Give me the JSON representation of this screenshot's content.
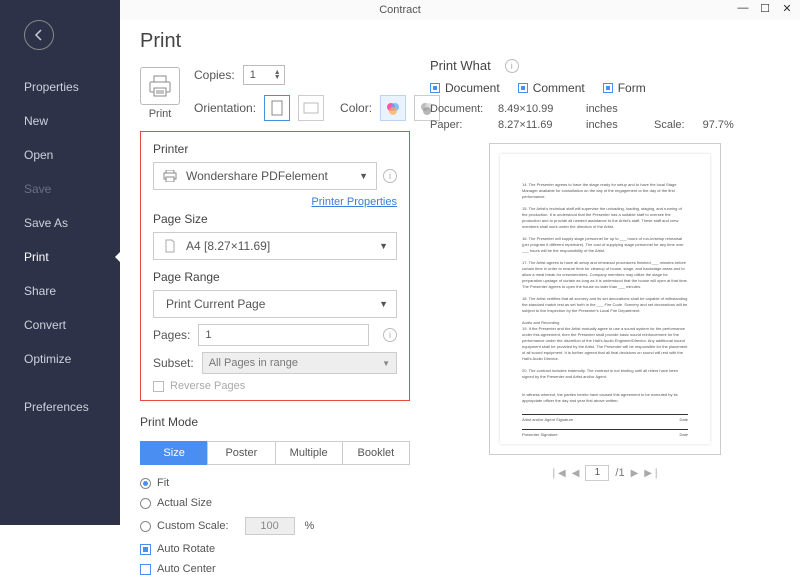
{
  "window": {
    "title": "Contract"
  },
  "sidebar": {
    "items": [
      {
        "label": "Properties"
      },
      {
        "label": "New"
      },
      {
        "label": "Open"
      },
      {
        "label": "Save"
      },
      {
        "label": "Save As"
      },
      {
        "label": "Print"
      },
      {
        "label": "Share"
      },
      {
        "label": "Convert"
      },
      {
        "label": "Optimize"
      },
      {
        "label": "Preferences"
      }
    ]
  },
  "page": {
    "title": "Print"
  },
  "top": {
    "print_label": "Print",
    "copies_label": "Copies:",
    "copies_value": "1",
    "orientation_label": "Orientation:",
    "color_label": "Color:"
  },
  "printer": {
    "section": "Printer",
    "value": "Wondershare PDFelement",
    "properties_link": "Printer Properties"
  },
  "page_size": {
    "section": "Page Size",
    "value": "A4 [8.27×11.69]"
  },
  "page_range": {
    "section": "Page Range",
    "value": "Print Current Page",
    "pages_label": "Pages:",
    "pages_value": "1",
    "subset_label": "Subset:",
    "subset_value": "All Pages in range",
    "reverse": "Reverse Pages"
  },
  "print_mode": {
    "section": "Print Mode",
    "tabs": [
      "Size",
      "Poster",
      "Multiple",
      "Booklet"
    ],
    "fit": "Fit",
    "actual": "Actual Size",
    "custom": "Custom Scale:",
    "custom_val": "100",
    "pct": "%",
    "auto_rotate": "Auto Rotate",
    "auto_center": "Auto Center"
  },
  "print_what": {
    "header": "Print What",
    "options": [
      "Document",
      "Comment",
      "Form"
    ],
    "doc_label": "Document:",
    "doc_dim": "8.49×10.99",
    "paper_label": "Paper:",
    "paper_dim": "8.27×11.69",
    "unit": "inches",
    "scale_label": "Scale:",
    "scale_val": "97.7%"
  },
  "pager": {
    "current": "1",
    "total": "/1"
  }
}
